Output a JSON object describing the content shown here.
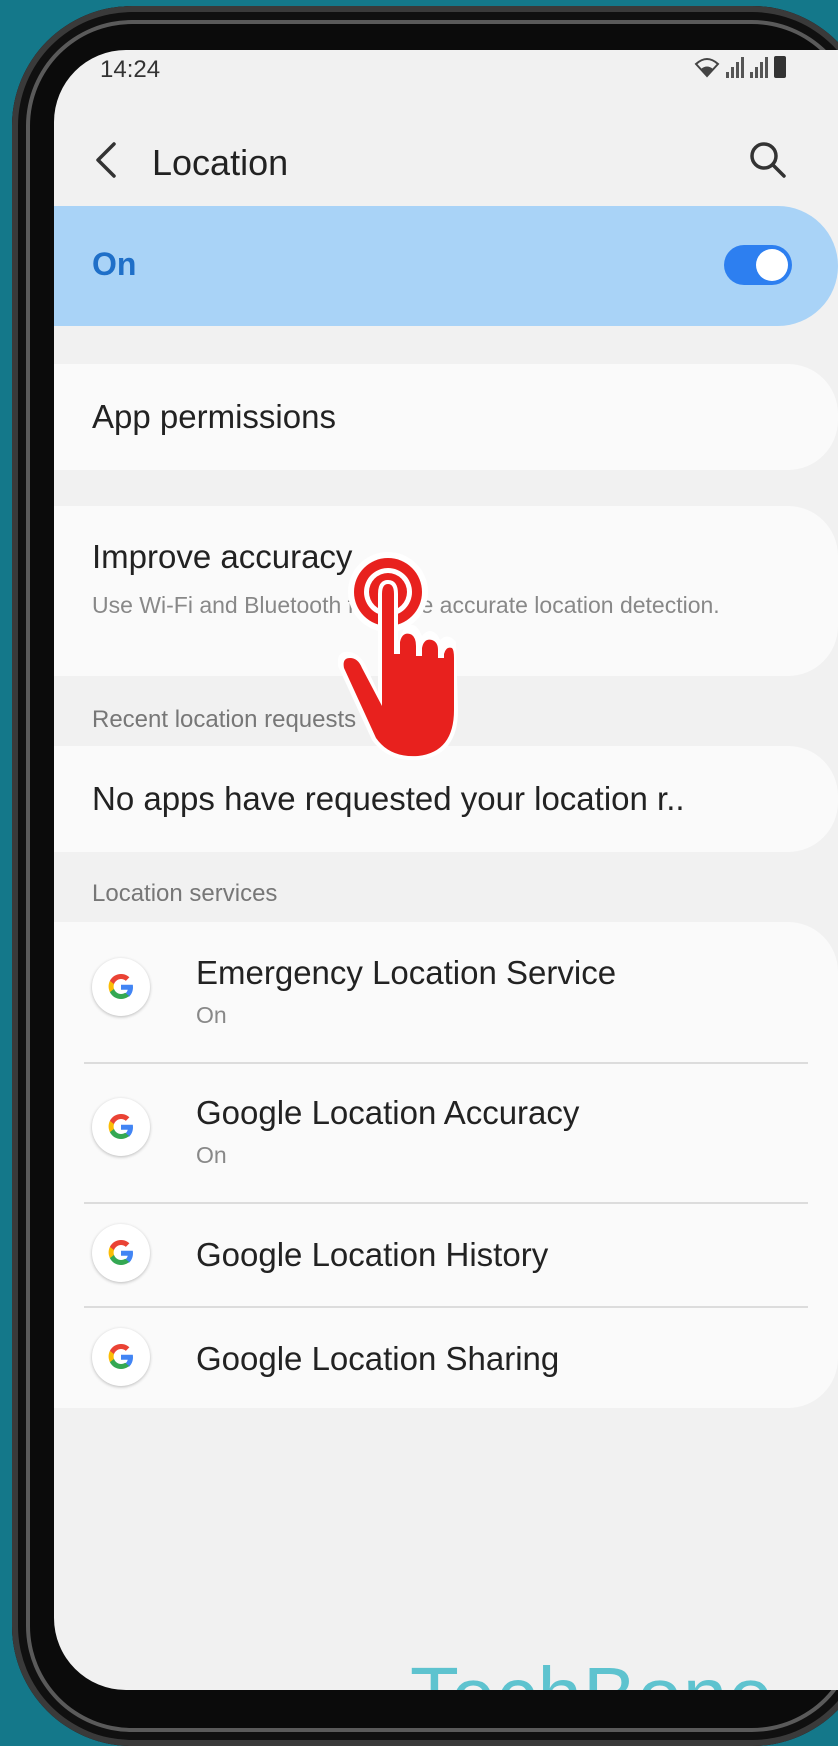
{
  "status_bar": {
    "time": "14:24"
  },
  "app_bar": {
    "title": "Location"
  },
  "master_toggle": {
    "label": "On",
    "state": true,
    "accent_color": "#2d7ff0"
  },
  "app_permissions": {
    "title": "App permissions"
  },
  "improve_accuracy": {
    "title": "Improve accuracy",
    "subtitle": "Use Wi-Fi and Bluetooth for more accurate location detection."
  },
  "recent_requests": {
    "section_label": "Recent location requests",
    "empty_text": "No apps have requested your location r.."
  },
  "location_services": {
    "section_label": "Location services",
    "items": [
      {
        "title": "Emergency Location Service",
        "subtitle": "On",
        "icon": "google-g-icon"
      },
      {
        "title": "Google Location Accuracy",
        "subtitle": "On",
        "icon": "google-g-icon"
      },
      {
        "title": "Google Location History",
        "subtitle": "",
        "icon": "google-g-icon"
      },
      {
        "title": "Google Location Sharing",
        "subtitle": "",
        "icon": "google-g-icon"
      }
    ]
  },
  "watermark": {
    "text": "TechBone"
  },
  "overlay": {
    "icon": "tap-hand-icon",
    "color": "#e8211e"
  }
}
